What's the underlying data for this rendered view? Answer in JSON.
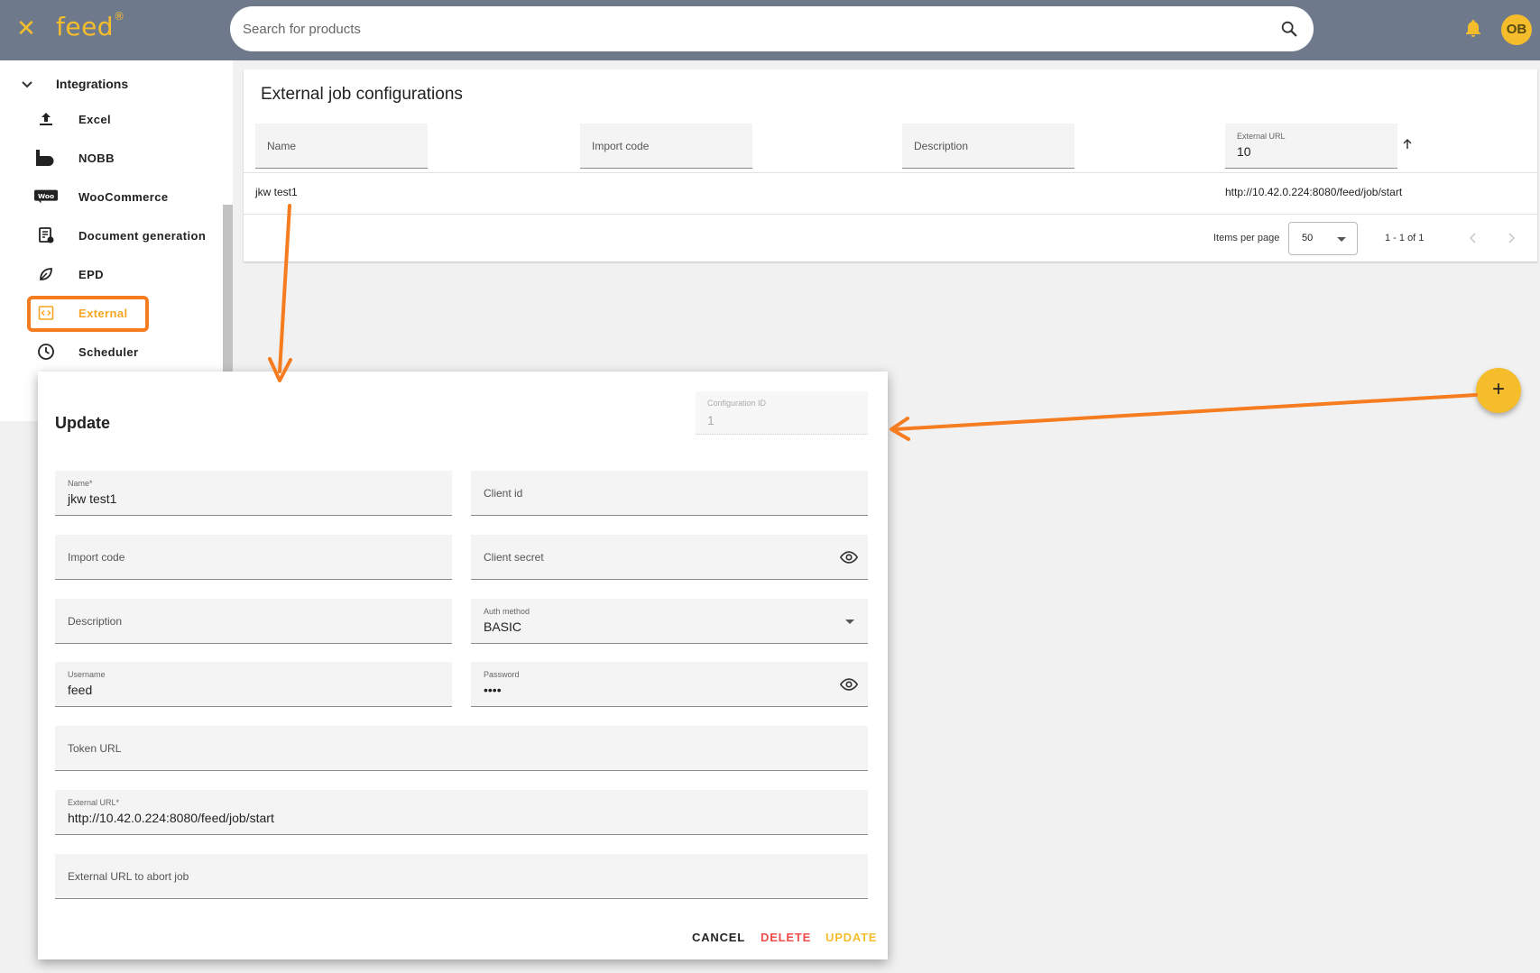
{
  "topbar": {
    "logo": "feed",
    "logo_mark": "®",
    "search_placeholder": "Search for products",
    "avatar_initials": "OB"
  },
  "sidebar": {
    "section": "Integrations",
    "items": [
      {
        "label": "Excel",
        "icon": "upload-icon"
      },
      {
        "label": "NOBB",
        "icon": "nobb-icon"
      },
      {
        "label": "WooCommerce",
        "icon": "woo-icon"
      },
      {
        "label": "Document generation",
        "icon": "document-icon"
      },
      {
        "label": "EPD",
        "icon": "leaf-icon"
      },
      {
        "label": "External",
        "icon": "code-icon"
      },
      {
        "label": "Scheduler",
        "icon": "clock-icon"
      }
    ],
    "active": "External"
  },
  "main": {
    "title": "External job configurations",
    "filters": {
      "name_placeholder": "Name",
      "import_code_placeholder": "Import code",
      "description_placeholder": "Description",
      "external_url_label": "External URL",
      "external_url_value": "10"
    },
    "rows": [
      {
        "name": "jkw test1",
        "import_code": "",
        "description": "",
        "external_url": "http://10.42.0.224:8080/feed/job/start"
      }
    ],
    "pagination": {
      "items_per_page_label": "Items per page",
      "items_per_page": "50",
      "range": "1 - 1 of 1"
    }
  },
  "fab": {
    "label": "+"
  },
  "dialog": {
    "title": "Update",
    "configuration_id_label": "Configuration ID",
    "configuration_id": "1",
    "name_label": "Name*",
    "name_value": "jkw test1",
    "client_id_placeholder": "Client id",
    "import_code_placeholder": "Import code",
    "client_secret_placeholder": "Client secret",
    "description_placeholder": "Description",
    "auth_method_label": "Auth method",
    "auth_method_value": "BASIC",
    "username_label": "Username",
    "username_value": "feed",
    "password_label": "Password",
    "password_value": "••••",
    "token_url_placeholder": "Token URL",
    "external_url_label": "External URL*",
    "external_url_value": "http://10.42.0.224:8080/feed/job/start",
    "abort_url_placeholder": "External URL to abort job",
    "cancel": "CANCEL",
    "delete": "DELETE",
    "update": "UPDATE"
  },
  "colors": {
    "topbar": "#6e7a8c",
    "accent": "#f5bd2c",
    "annotation": "#f57c1f",
    "danger": "#f04b4b"
  }
}
